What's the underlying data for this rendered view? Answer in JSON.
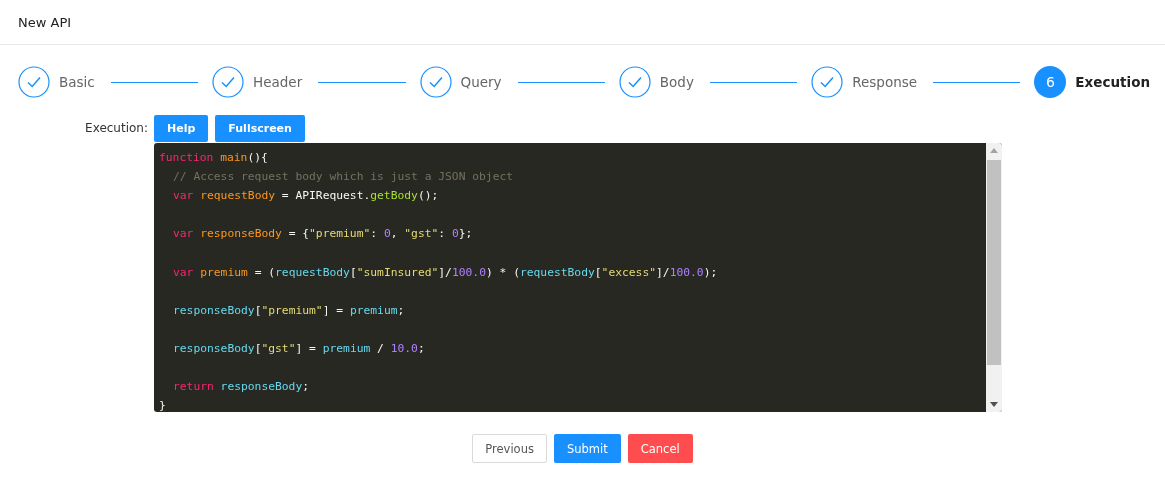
{
  "window": {
    "title": "New API"
  },
  "steps": [
    {
      "label": "Basic",
      "completed": true,
      "selected": false
    },
    {
      "label": "Header",
      "completed": true,
      "selected": false
    },
    {
      "label": "Query",
      "completed": true,
      "selected": false
    },
    {
      "label": "Body",
      "completed": true,
      "selected": false
    },
    {
      "label": "Response",
      "completed": true,
      "selected": false
    },
    {
      "label": "Execution",
      "completed": false,
      "selected": true,
      "number": "6"
    }
  ],
  "form": {
    "label": "Execution:",
    "buttons": [
      {
        "label": "Help"
      },
      {
        "label": "Fullscreen"
      }
    ]
  },
  "editor": {
    "lines": [
      {
        "indented": false,
        "gap_before": false,
        "tokens": [
          {
            "kind": "keyword",
            "text": "function "
          },
          {
            "kind": "name",
            "text": "main"
          },
          {
            "kind": "plain",
            "text": "(){"
          }
        ]
      },
      {
        "indented": true,
        "gap_before": false,
        "tokens": [
          {
            "kind": "comment",
            "text": "// Access request body which is just a JSON object"
          }
        ]
      },
      {
        "indented": true,
        "gap_before": false,
        "tokens": [
          {
            "kind": "keyword",
            "text": "var "
          },
          {
            "kind": "name",
            "text": "requestBody"
          },
          {
            "kind": "plain",
            "text": " = APIRequest."
          },
          {
            "kind": "call",
            "text": "getBody"
          },
          {
            "kind": "plain",
            "text": "();"
          }
        ]
      },
      {
        "indented": true,
        "gap_before": true,
        "tokens": [
          {
            "kind": "keyword",
            "text": "var "
          },
          {
            "kind": "name",
            "text": "responseBody"
          },
          {
            "kind": "plain",
            "text": " = {"
          },
          {
            "kind": "string",
            "text": "\"premium\""
          },
          {
            "kind": "plain",
            "text": ": "
          },
          {
            "kind": "number",
            "text": "0"
          },
          {
            "kind": "plain",
            "text": ", "
          },
          {
            "kind": "string",
            "text": "\"gst\""
          },
          {
            "kind": "plain",
            "text": ": "
          },
          {
            "kind": "number",
            "text": "0"
          },
          {
            "kind": "plain",
            "text": "};"
          }
        ]
      },
      {
        "indented": true,
        "gap_before": true,
        "tokens": [
          {
            "kind": "keyword",
            "text": "var "
          },
          {
            "kind": "name",
            "text": "premium"
          },
          {
            "kind": "plain",
            "text": " = ("
          },
          {
            "kind": "ident",
            "text": "requestBody"
          },
          {
            "kind": "plain",
            "text": "["
          },
          {
            "kind": "string",
            "text": "\"sumInsured\""
          },
          {
            "kind": "plain",
            "text": "]/"
          },
          {
            "kind": "number",
            "text": "100.0"
          },
          {
            "kind": "plain",
            "text": ") * ("
          },
          {
            "kind": "ident",
            "text": "requestBody"
          },
          {
            "kind": "plain",
            "text": "["
          },
          {
            "kind": "string",
            "text": "\"excess\""
          },
          {
            "kind": "plain",
            "text": "]/"
          },
          {
            "kind": "number",
            "text": "100.0"
          },
          {
            "kind": "plain",
            "text": ");"
          }
        ]
      },
      {
        "indented": true,
        "gap_before": true,
        "tokens": [
          {
            "kind": "ident",
            "text": "responseBody"
          },
          {
            "kind": "plain",
            "text": "["
          },
          {
            "kind": "string",
            "text": "\"premium\""
          },
          {
            "kind": "plain",
            "text": "] = "
          },
          {
            "kind": "ident",
            "text": "premium"
          },
          {
            "kind": "plain",
            "text": ";"
          }
        ]
      },
      {
        "indented": true,
        "gap_before": true,
        "tokens": [
          {
            "kind": "ident",
            "text": "responseBody"
          },
          {
            "kind": "plain",
            "text": "["
          },
          {
            "kind": "string",
            "text": "\"gst\""
          },
          {
            "kind": "plain",
            "text": "] = "
          },
          {
            "kind": "ident",
            "text": "premium"
          },
          {
            "kind": "plain",
            "text": " / "
          },
          {
            "kind": "number",
            "text": "10.0"
          },
          {
            "kind": "plain",
            "text": ";"
          }
        ]
      },
      {
        "indented": true,
        "gap_before": true,
        "tokens": [
          {
            "kind": "keyword",
            "text": "return "
          },
          {
            "kind": "ident",
            "text": "responseBody"
          },
          {
            "kind": "plain",
            "text": ";"
          }
        ]
      },
      {
        "indented": false,
        "gap_before": false,
        "tokens": [
          {
            "kind": "plain",
            "text": "}"
          }
        ]
      }
    ]
  },
  "actions": [
    {
      "label": "Previous",
      "kind": "default"
    },
    {
      "label": "Submit",
      "kind": "primary"
    },
    {
      "label": "Cancel",
      "kind": "danger"
    }
  ]
}
